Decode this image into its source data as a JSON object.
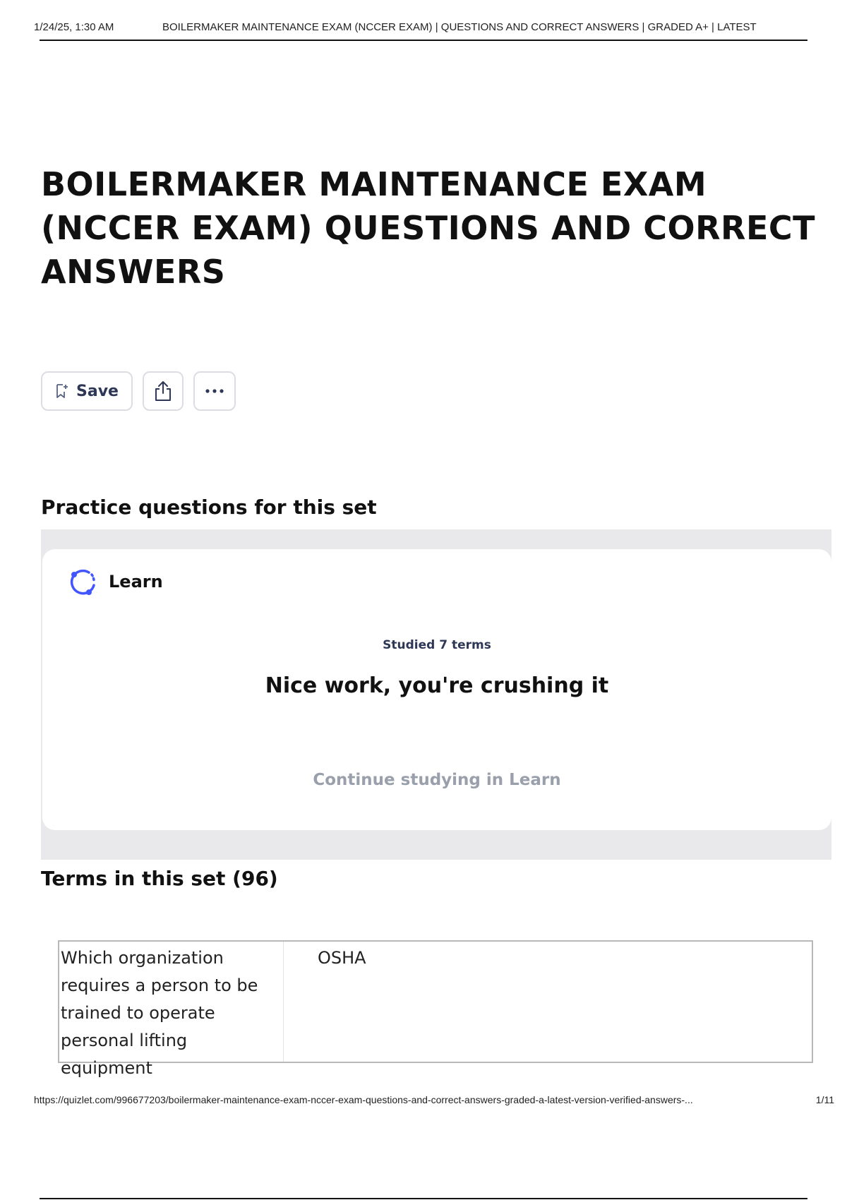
{
  "header": {
    "datetime": "1/24/25, 1:30 AM",
    "title": "BOILERMAKER MAINTENANCE EXAM (NCCER EXAM) | QUESTIONS AND CORRECT ANSWERS | GRADED A+ | LATEST"
  },
  "document": {
    "title": "BOILERMAKER MAINTENANCE EXAM (NCCER EXAM) QUESTIONS AND CORRECT ANSWERS"
  },
  "actions": {
    "save_label": "Save",
    "share_icon": "share-icon",
    "more_icon": "more-icon"
  },
  "practice": {
    "heading": "Practice questions for this set",
    "learn_label": "Learn",
    "studied_text": "Studied 7 terms",
    "message": "Nice work, you're crushing it",
    "continue_link": "Continue studying in Learn",
    "accent_color": "#4255ff"
  },
  "terms": {
    "heading": "Terms in this set (96)",
    "items": [
      {
        "question": "Which organization requires a person to be trained to operate personal lifting equipment",
        "answer": "OSHA"
      }
    ]
  },
  "footer": {
    "url": "https://quizlet.com/996677203/boilermaker-maintenance-exam-nccer-exam-questions-and-correct-answers-graded-a-latest-version-verified-answers-...",
    "page": "1/11"
  }
}
